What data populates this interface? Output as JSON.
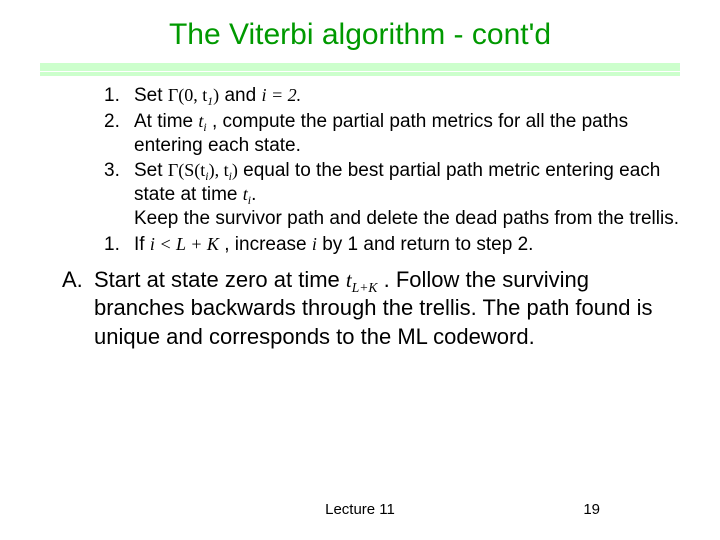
{
  "title": "The Viterbi algorithm - cont'd",
  "steps": {
    "n1": "1.",
    "n2": "2.",
    "n3": "3.",
    "n4": "1.",
    "s1a": "Set ",
    "s1_math1": "Γ(0, t",
    "s1_sub1": "1",
    "s1_math1b": ")",
    "s1b": " and ",
    "s1_math2": "i = 2.",
    "s2a": "At time ",
    "s2_math1": "t",
    "s2_sub1": "i",
    "s2b": " , compute the partial path metrics for all the paths entering each state.",
    "s3a": "Set ",
    "s3_math1": "Γ(S(t",
    "s3_sub1": "i",
    "s3_math1b": "), t",
    "s3_sub2": "i",
    "s3_math1c": ")",
    "s3b": " equal to the best partial path metric entering each state at time ",
    "s3_math2": "t",
    "s3_sub3": "i",
    "s3c": ".",
    "s3d": "Keep the survivor path and delete the dead paths from the trellis.",
    "s4a": "If ",
    "s4_math1": "i < L + K",
    "s4b": " , increase ",
    "s4_math2": "i",
    "s4c": " by 1 and return to step 2."
  },
  "outer": {
    "nA": "A.",
    "tA1": "Start at state zero at time ",
    "tA_math": "t",
    "tA_sub": "L+K",
    "tA2": ". Follow the surviving branches backwards through the trellis. The path found is unique and corresponds to the ML codeword."
  },
  "footer": {
    "lecture": "Lecture 11",
    "page": "19"
  }
}
